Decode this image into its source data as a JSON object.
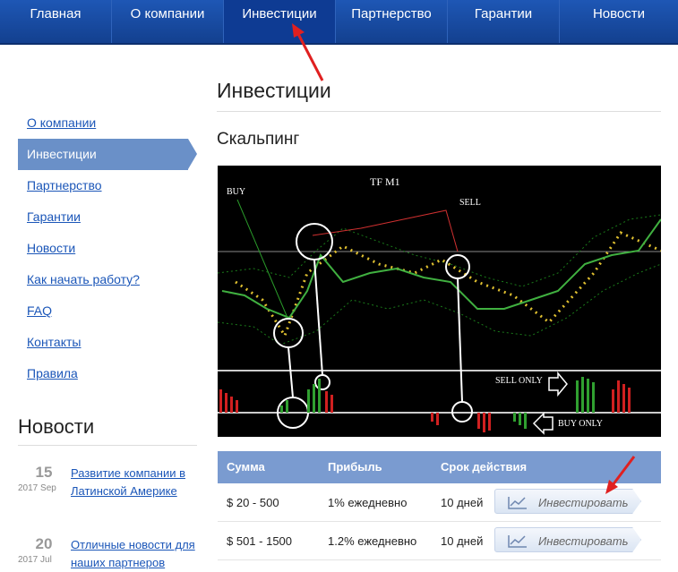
{
  "nav": {
    "items": [
      "Главная",
      "О компании",
      "Инвестиции",
      "Партнерство",
      "Гарантии",
      "Новости"
    ],
    "active_index": 2
  },
  "sidebar": {
    "items": [
      "О компании",
      "Инвестиции",
      "Партнерство",
      "Гарантии",
      "Новости",
      "Как начать работу?",
      "FAQ",
      "Контакты",
      "Правила"
    ],
    "active_index": 1
  },
  "news": {
    "title": "Новости",
    "items": [
      {
        "day": "15",
        "date": "2017 Sep",
        "text": "Развитие компании в Латинской Америке"
      },
      {
        "day": "20",
        "date": "2017 Jul",
        "text": "Отличные новости для наших партнеров"
      }
    ]
  },
  "main": {
    "title": "Инвестиции",
    "subtitle": "Скальпинг"
  },
  "chart_labels": {
    "tf": "TF M1",
    "buy": "BUY",
    "sell": "SELL",
    "sell_only": "SELL ONLY",
    "buy_only": "BUY ONLY"
  },
  "table": {
    "headers": [
      "Сумма",
      "Прибыль",
      "Срок действия"
    ],
    "rows": [
      {
        "sum": "$ 20 - 500",
        "profit": "1% ежедневно",
        "term": "10 дней",
        "button": "Инвестировать"
      },
      {
        "sum": "$ 501 - 1500",
        "profit": "1.2% ежедневно",
        "term": "10 дней",
        "button": "Инвестировать"
      }
    ]
  },
  "colors": {
    "nav_bg": "#1a4fa8",
    "accent": "#6a90c8",
    "link": "#1b56b8",
    "annotation_arrow": "#e02020"
  }
}
